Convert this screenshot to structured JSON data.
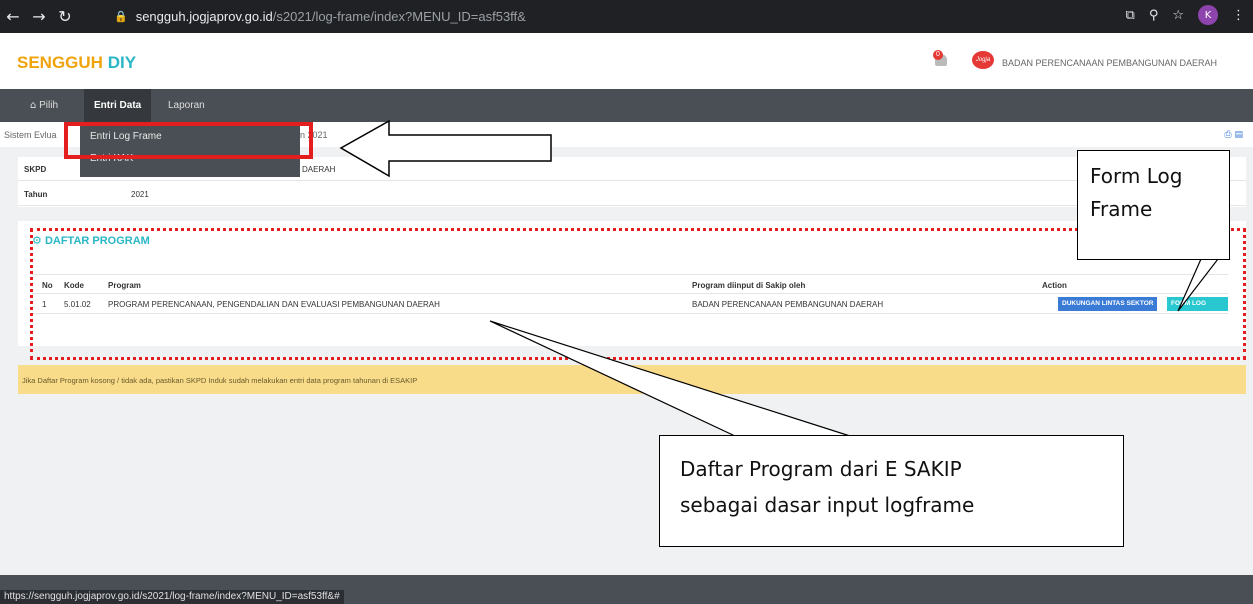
{
  "browser": {
    "url_host": "sengguh.jogjaprov.go.id",
    "url_path": "/s2021/log-frame/index?MENU_ID=asf53ff&",
    "status_url": "https://sengguh.jogjaprov.go.id/s2021/log-frame/index?MENU_ID=asf53ff&#",
    "profile_initial": "K"
  },
  "header": {
    "brand_part1": "SENGGUH",
    "brand_part2": "DIY",
    "notification_count": "0",
    "org_logo_text": "Jogja",
    "org_name": "BADAN PERENCANAAN PEMBANGUNAN DAERAH"
  },
  "nav": {
    "items": [
      {
        "label": "Pilih",
        "icon": "home-icon"
      },
      {
        "label": "Entri Data"
      },
      {
        "label": "Laporan"
      }
    ],
    "dropdown": [
      "Entri Log Frame",
      "Entri KAK"
    ]
  },
  "breadcrumb": {
    "left": "Sistem Ev",
    "left_tail": "lua",
    "right": "n 2021"
  },
  "info": {
    "rows": [
      {
        "label": "SKPD",
        "value": "DAERAH"
      },
      {
        "label": "Tahun",
        "value": "2021"
      }
    ]
  },
  "program": {
    "title": "DAFTAR PROGRAM",
    "columns": [
      "No",
      "Kode",
      "Program",
      "Program diinput di Sakip oleh",
      "Action"
    ],
    "rows": [
      {
        "no": "1",
        "kode": "5.01.02",
        "program": "PROGRAM PERENCANAAN, PENGENDALIAN DAN EVALUASI PEMBANGUNAN DAERAH",
        "oleh": "BADAN PERENCANAAN PEMBANGUNAN DAERAH",
        "btn1": "DUKUNGAN LINTAS SEKTOR",
        "btn2": "FORM LOG FRAME"
      }
    ]
  },
  "alert": "Jika Daftar Program kosong / tidak ada, pastikan SKPD Induk sudah melakukan entri data program tahunan di ESAKIP",
  "annotations": {
    "callout1_line1": "Form Log",
    "callout1_line2": "Frame",
    "callout2_line1": "Daftar Program dari E SAKIP",
    "callout2_line2": "sebagai dasar input logframe"
  }
}
